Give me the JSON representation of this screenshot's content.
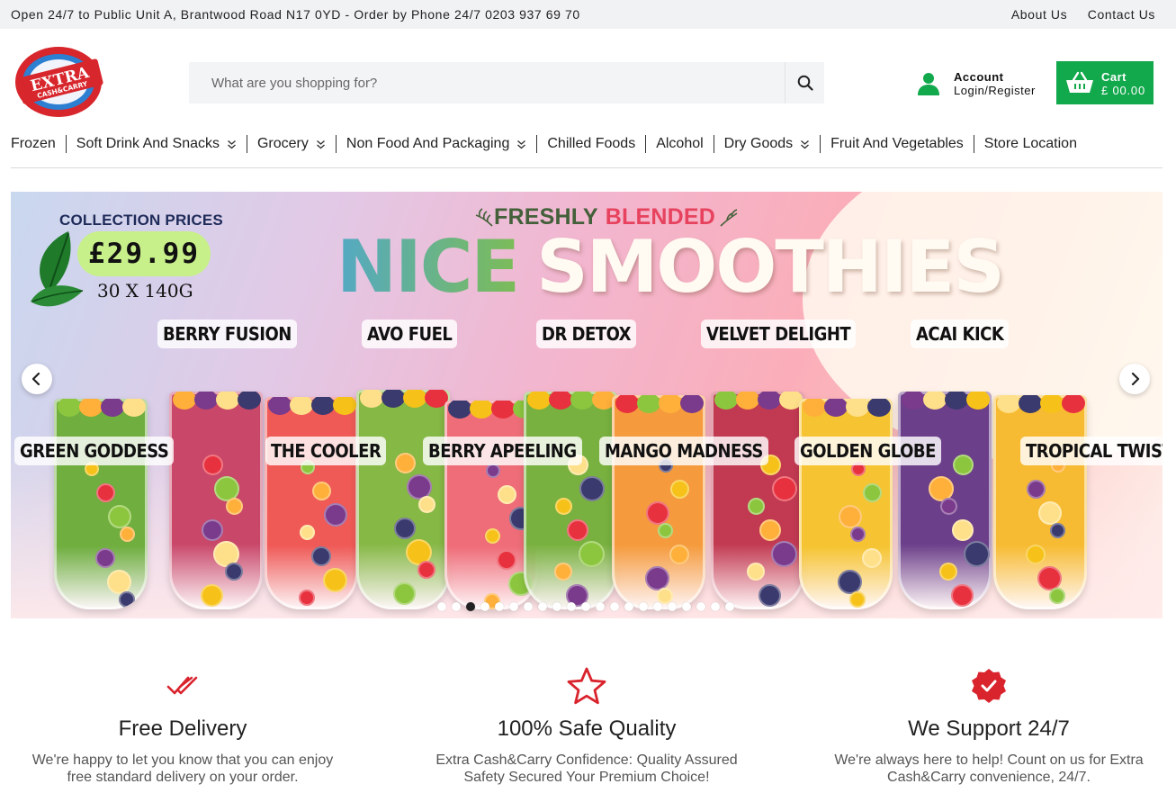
{
  "topbar": {
    "announcement": "Open 24/7 to Public Unit A, Brantwood Road N17 0YD - Order by Phone 24/7 0203 937 69 70",
    "links": [
      "About Us",
      "Contact Us"
    ]
  },
  "header": {
    "logo_text_top": "EXTRA",
    "logo_text_bottom": "CASH&CARRY",
    "search_placeholder": "What are you shopping for?",
    "account_label": "Account",
    "account_sub": "Login/Register",
    "cart_label": "Cart",
    "cart_total": "£ 00.00"
  },
  "nav": {
    "items": [
      {
        "label": "Frozen",
        "dropdown": false
      },
      {
        "label": "Soft Drink And Snacks",
        "dropdown": true
      },
      {
        "label": "Grocery",
        "dropdown": true
      },
      {
        "label": "Non Food And Packaging",
        "dropdown": true
      },
      {
        "label": "Chilled Foods",
        "dropdown": false
      },
      {
        "label": "Alcohol",
        "dropdown": false
      },
      {
        "label": "Dry Goods",
        "dropdown": true
      },
      {
        "label": "Fruit And Vegetables",
        "dropdown": false
      },
      {
        "label": "Store Location",
        "dropdown": false
      }
    ]
  },
  "banner": {
    "collection_label": "COLLECTION PRICES",
    "price": "£29.99",
    "pack_size": "30 X 140G",
    "tagline_part1": "FRESHLY",
    "tagline_part2": "BLENDED",
    "headline_part1": "NICE",
    "headline_part2": "SMOOTHIES",
    "flavours_top": [
      "BERRY FUSION",
      "AVO FUEL",
      "DR DETOX",
      "VELVET DELIGHT",
      "ACAI KICK"
    ],
    "flavours_bottom": [
      "GREEN GODDESS",
      "THE COOLER",
      "BERRY APEELING",
      "MANGO MADNESS",
      "GOLDEN GLOBE",
      "TROPICAL TWIST"
    ],
    "glass_colors": [
      "#6fae3f",
      "#c9486a",
      "#ef5a57",
      "#86b845",
      "#ef6d79",
      "#78b13f",
      "#f59b3d",
      "#c23a52",
      "#f6c432",
      "#6c3f8a",
      "#f7bb33"
    ],
    "slide_count": 21,
    "active_slide": 2
  },
  "features": [
    {
      "icon": "double-check-icon",
      "title": "Free Delivery",
      "desc": "We're happy to let you know that you can enjoy free standard delivery on your order."
    },
    {
      "icon": "star-outline-icon",
      "title": "100% Safe Quality",
      "desc": "Extra Cash&Carry Confidence: Quality Assured Safety Secured Your Premium Choice!"
    },
    {
      "icon": "verified-badge-icon",
      "title": "We Support 24/7",
      "desc": "We're always here to help! Count on us for Extra Cash&Carry convenience, 24/7."
    }
  ],
  "colors": {
    "brand_red": "#d7262c",
    "brand_blue": "#2c7fd1",
    "accent_green": "#12a84c",
    "icon_red": "#d9232d"
  }
}
